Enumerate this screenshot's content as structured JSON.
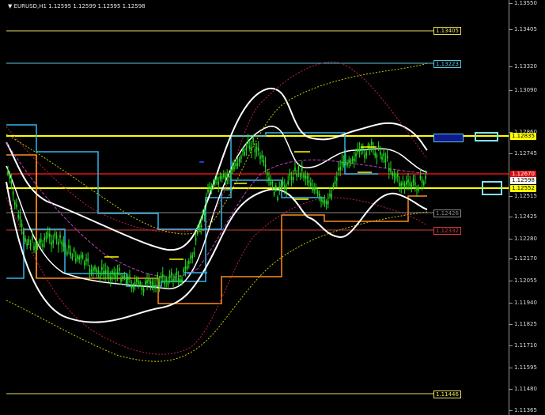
{
  "header": {
    "dropdown_arrow": "chevron-down-icon",
    "symbol_info": "EURUSD,H1  1.12595 1.12599 1.12595 1.12598"
  },
  "price_axis": {
    "ticks": [
      "1.13550",
      "1.13405",
      "1.13320",
      "1.13090",
      "1.12860",
      "1.12745",
      "1.12515",
      "1.12425",
      "1.12280",
      "1.12170",
      "1.12055",
      "1.11940",
      "1.11825",
      "1.11710",
      "1.11595",
      "1.11480",
      "1.11365"
    ],
    "current_price_label": "1.12598",
    "red_level_label": "1.12670",
    "yellow_level_label": "1.12835",
    "yellow2_level_label": "1.12552"
  },
  "levels": [
    {
      "name": "level-1-13405",
      "label": "1.13405",
      "color": "#e8e05a"
    },
    {
      "name": "level-1-13223",
      "label": "1.13223",
      "color": "#57c6e0"
    },
    {
      "name": "level-1-12835",
      "label": "1.12835",
      "color": "#ffff00"
    },
    {
      "name": "level-1-12426",
      "label": "1.12426",
      "color": "#8a8a8a"
    },
    {
      "name": "level-1-12332",
      "label": "1.12332",
      "color": "#d23c3c"
    },
    {
      "name": "level-1-11446",
      "label": "1.11446",
      "color": "#e8e05a"
    }
  ],
  "colors": {
    "candles": "#22dd22",
    "bands": "#ffffff",
    "channel_orange": "#ff8c1a",
    "channel_blue": "#35b4e8",
    "red_line": "#e01010",
    "yellow_line": "#ffff00",
    "dotted_red": "#c02040",
    "dotted_yellow": "#c8c800",
    "magenta": "#c040c0"
  }
}
